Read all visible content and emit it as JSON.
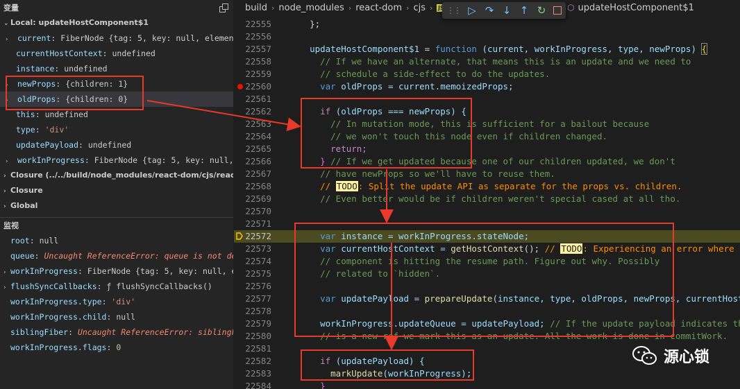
{
  "sidebar": {
    "variables_title": "变量",
    "scopes": [
      {
        "label": "Local: updateHostComponent$1"
      },
      {
        "label": "Closure (../../build/node_modules/react-dom/cjs/react-do"
      },
      {
        "label": "Closure"
      },
      {
        "label": "Global"
      }
    ],
    "locals": [
      {
        "name": "current",
        "value": "FiberNode {tag: 5, key: null, element…",
        "expandable": true
      },
      {
        "name": "currentHostContext",
        "value": "undefined",
        "expandable": false
      },
      {
        "name": "instance",
        "value": "undefined",
        "expandable": false
      },
      {
        "name": "newProps",
        "value": "{children: 1}",
        "expandable": true
      },
      {
        "name": "oldProps",
        "value": "{children: 0}",
        "expandable": true
      },
      {
        "name": "this",
        "value": "undefined",
        "expandable": false
      },
      {
        "name": "type",
        "value": "'div'",
        "expandable": false
      },
      {
        "name": "updatePayload",
        "value": "undefined",
        "expandable": false
      },
      {
        "name": "workInProgress",
        "value": "FiberNode {tag: 5, key: null, work…",
        "expandable": true
      }
    ],
    "watch_title": "监视",
    "watch": [
      {
        "name": "root",
        "value": "null"
      },
      {
        "name": "queue",
        "value": "Uncaught ReferenceError: queue is not de…"
      },
      {
        "name": "workInProgress",
        "value": "FiberNode {tag: 5, key: null, e…"
      },
      {
        "name": "flushSyncCallbacks",
        "value": "ƒ flushSyncCallbacks()"
      },
      {
        "name": "workInProgress.type",
        "value": "'div'"
      },
      {
        "name": "workInProgress.child",
        "value": "null"
      },
      {
        "name": "siblingFiber",
        "value": "Uncaught ReferenceError: siblingF…"
      },
      {
        "name": "workInProgress.flags",
        "value": "0"
      }
    ]
  },
  "editor": {
    "breadcrumb": [
      "build",
      "node_modules",
      "react-dom",
      "cjs"
    ],
    "js_badge": "JS",
    "symbol": "updateHostComponent$1",
    "current_line": "22572",
    "breakpoint_line": "22560",
    "line_numbers": [
      "22555",
      "22556",
      "22557",
      "22558",
      "22559",
      "22560",
      "22561",
      "22562",
      "22563",
      "22564",
      "22565",
      "22566",
      "22567",
      "22568",
      "22569",
      "22570",
      "22571",
      "22572",
      "22573",
      "22574",
      "22575",
      "22576",
      "22577",
      "22578",
      "22579",
      "22580",
      "22581",
      "22582",
      "22583",
      "22584"
    ],
    "todo_label": "TODO",
    "code": {
      "l1_punct": "};",
      "l3_name": "updateHostComponent$1",
      "l3_eq": " = ",
      "l3_kw": "function",
      "l3_params": "(current, workInProgress, type, newProps)",
      "l3_brace": "{",
      "l4": "// If we have an alternate, that means this is an update and we need to",
      "l5": "// schedule a side-effect to do the updates.",
      "l6_kw": "var",
      "l6_rest": " oldProps = current.memoizedProps;",
      "l8_if": "if",
      "l8_cond": " (oldProps === newProps) {",
      "l9": "// In mutation mode, this is sufficient for a bailout because",
      "l10": "// we won't touch this node even if children changed.",
      "l11": "return;",
      "l12_brace": "}",
      "l12_com": " // If we get updated because one of our children updated, we don't",
      "l13": "// have newProps so we'll have to reuse them.",
      "l14_pre": "// ",
      "l14_post": ": Split the update API as separate for the props vs. children.",
      "l15": "// Even better would be if children weren't special cased at all tho.",
      "l18_kw": "var",
      "l18_rest": " instance = workInProgress.stateNode;",
      "l19_kw": "var",
      "l19_mid": " currentHostContext = ",
      "l19_fn": "getHostContext",
      "l19_end": "(); ",
      "l19_com_pre": "// ",
      "l19_com_post": ": Experiencing an error where oldPro",
      "l20": "// component is hitting the resume path. Figure out why. Possibly",
      "l21": "// related to `hidden`.",
      "l23_kw": "var",
      "l23_mid": " updatePayload = ",
      "l23_fn": "prepareUpdate",
      "l23_rest": "(instance, type, oldProps, newProps, currentHostConte",
      "l25_code": "workInProgress.updateQueue = updatePayload; ",
      "l25_com": "// If the update payload indicates that th",
      "l26": "// is a new ref we mark this as an update. All the work is done in commitWork.",
      "l28_if": "if",
      "l28_cond": " (updatePayload) {",
      "l29_fn": "markUpdate",
      "l29_rest": "(workInProgress);",
      "l30": "}"
    }
  },
  "watermark": {
    "text": "源心锁"
  },
  "colors": {
    "annotation_red": "#e8392a",
    "current_line_bg": "#4b4a21",
    "breakpoint": "#e51400"
  }
}
